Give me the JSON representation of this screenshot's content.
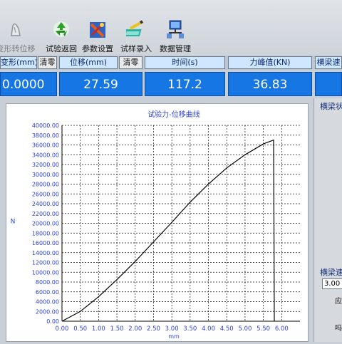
{
  "toolbar": {
    "items": [
      {
        "label": "变形转位移",
        "icon": "mouse-hand-icon",
        "enabled": false
      },
      {
        "label": "试验返回",
        "icon": "recycle-icon",
        "enabled": true
      },
      {
        "label": "参数设置",
        "icon": "tools-icon",
        "enabled": true
      },
      {
        "label": "试样录入",
        "icon": "pencil-book-icon",
        "enabled": true
      },
      {
        "label": "数据管理",
        "icon": "network-icon",
        "enabled": true
      }
    ]
  },
  "readouts": {
    "deformation": {
      "label": "变形(mm)",
      "value": "0.0000",
      "zero_label": "清零"
    },
    "displacement": {
      "label": "位移(mm)",
      "value": "27.59",
      "zero_label": "清零"
    },
    "time": {
      "label": "时间(s)",
      "value": "117.2"
    },
    "peak_force": {
      "label": "力峰值(KN)",
      "value": "36.83"
    },
    "beam_partial": {
      "label": "横梁速"
    }
  },
  "side": {
    "beam_status_label": "横梁状",
    "beam_speed_label": "横梁速",
    "beam_speed_value": "3.00",
    "fragment_1": "应",
    "fragment_2": "吗"
  },
  "colors": {
    "readout_bg": "#1677e4",
    "header_bg": "#cfe6ff",
    "curve": "#000000",
    "grid": "#000000"
  },
  "chart_data": {
    "type": "line",
    "title": "试验力-位移曲线",
    "xlabel": "mm",
    "ylabel": "N",
    "xlim": [
      0,
      6.5
    ],
    "ylim": [
      0,
      40000
    ],
    "x_ticks": [
      "0.00",
      "0.50",
      "1.00",
      "1.50",
      "2.00",
      "2.50",
      "3.00",
      "3.50",
      "4.00",
      "4.50",
      "5.00",
      "5.50",
      "6.00"
    ],
    "y_ticks": [
      "0.00",
      "2000.00",
      "4000.00",
      "6000.00",
      "8000.00",
      "10000.00",
      "12000.00",
      "14000.00",
      "16000.00",
      "18000.00",
      "20000.00",
      "22000.00",
      "24000.00",
      "26000.00",
      "28000.00",
      "30000.00",
      "32000.00",
      "34000.00",
      "36000.00",
      "38000.00",
      "40000.00"
    ],
    "grid": true,
    "series": [
      {
        "x": [
          0,
          0.5,
          1.0,
          1.5,
          2.0,
          2.5,
          3.0,
          3.5,
          4.0,
          4.5,
          5.0,
          5.5,
          5.78,
          5.79,
          5.8
        ],
        "y": [
          0,
          2000,
          5000,
          8500,
          12200,
          16200,
          20200,
          24300,
          28000,
          31300,
          34000,
          36200,
          37000,
          20000,
          0
        ]
      }
    ]
  }
}
